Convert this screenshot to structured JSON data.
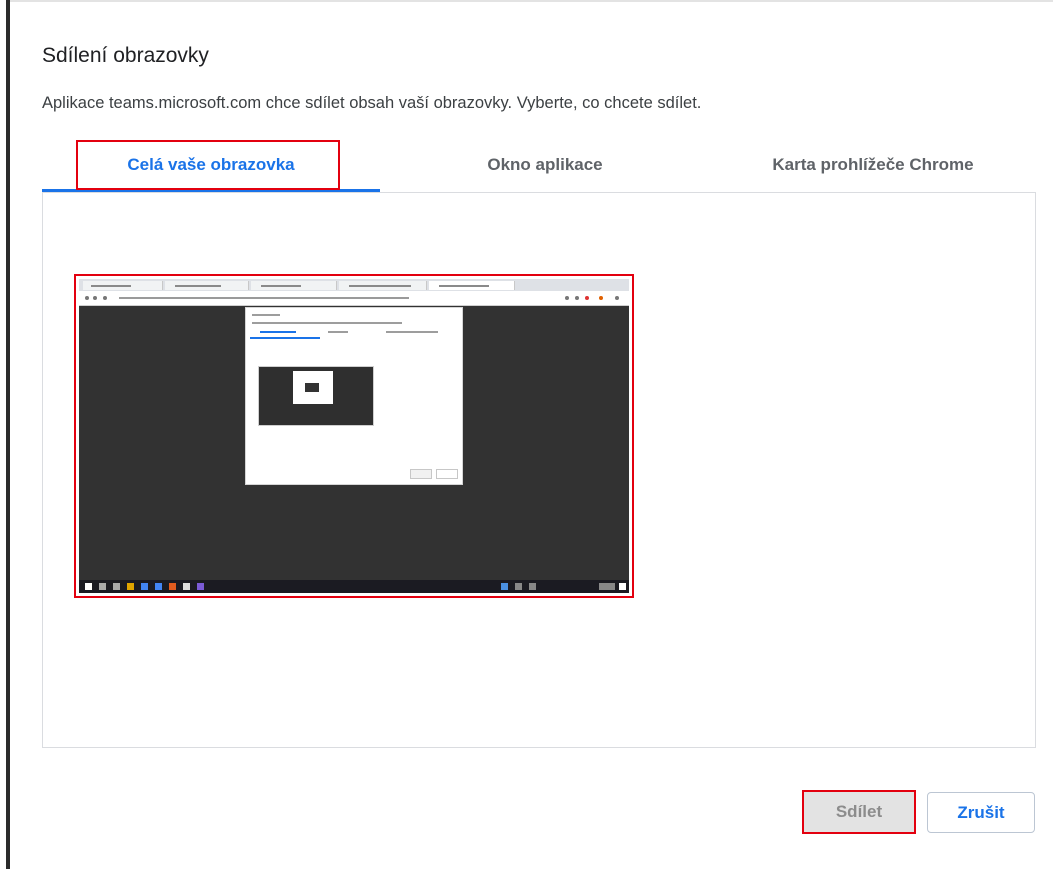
{
  "dialog": {
    "title": "Sdílení obrazovky",
    "description": "Aplikace teams.microsoft.com chce sdílet obsah vaší obrazovky. Vyberte, co chcete sdílet."
  },
  "tabs": [
    {
      "label": "Celá vaše obrazovka",
      "active": true
    },
    {
      "label": "Okno aplikace",
      "active": false
    },
    {
      "label": "Karta prohlížeče Chrome",
      "active": false
    }
  ],
  "buttons": {
    "share_label": "Sdílet",
    "cancel_label": "Zrušit"
  },
  "colors": {
    "accent": "#1a73e8",
    "highlight": "#e3000f",
    "screen_background": "#323232",
    "share_button_bg": "#e3e3e3"
  }
}
